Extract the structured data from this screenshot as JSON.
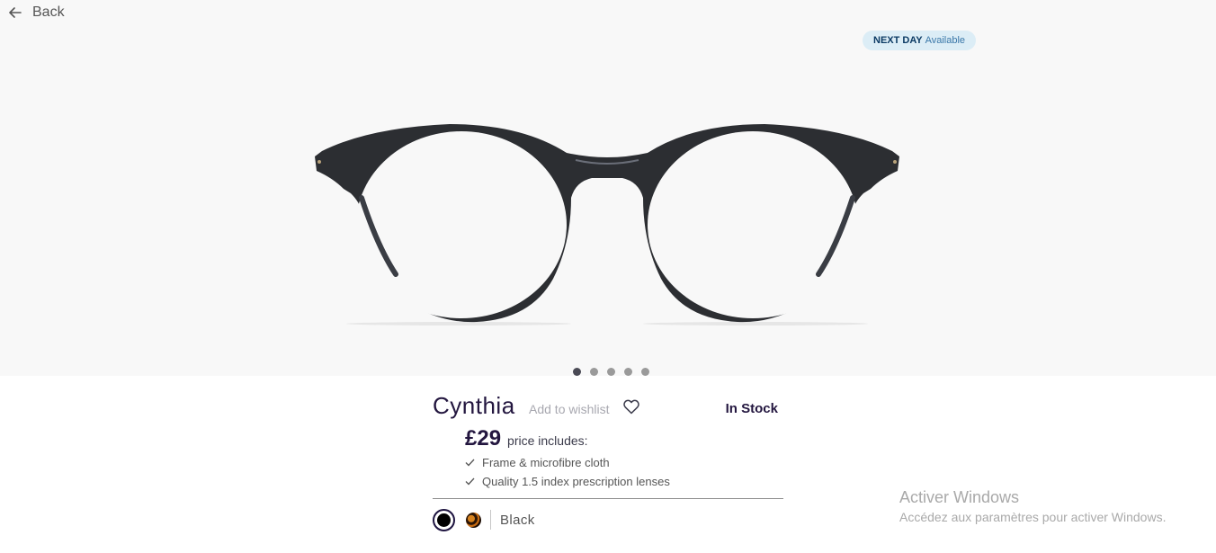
{
  "nav": {
    "back_label": "Back"
  },
  "badge": {
    "bold": "NEXT DAY",
    "normal": "Available"
  },
  "carousel": {
    "total": 5,
    "active_index": 1
  },
  "product": {
    "name": "Cynthia",
    "wishlist_label": "Add to wishlist",
    "stock": "In Stock",
    "price": "£29",
    "price_includes": "price includes:",
    "features": [
      "Frame & microfibre cloth",
      "Quality 1.5 index prescription lenses"
    ],
    "selected_color": "Black"
  },
  "colors": {
    "frame": "#2c2e32",
    "brand_dark": "#23163f",
    "badge_bg": "#dcedf6"
  },
  "watermark": {
    "title": "Activer Windows",
    "subtitle": "Accédez aux paramètres pour activer Windows."
  }
}
